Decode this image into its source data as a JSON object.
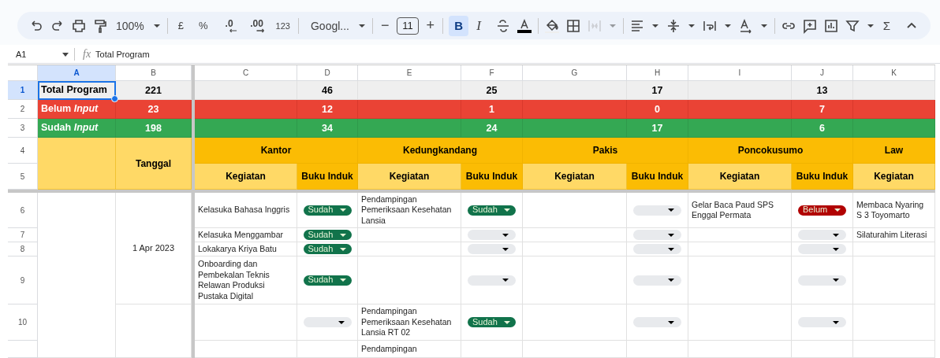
{
  "toolbar": {
    "zoom": "100%",
    "currency": "£",
    "percent": "%",
    "decrease_decimal": ".0",
    "increase_decimal": ".00",
    "number_format": "123",
    "font": "Googl...",
    "decrement": "−",
    "font_size": "11",
    "increment": "+",
    "bold": {
      "label": "B",
      "selected": true
    },
    "italic": "I",
    "merge_cells": {
      "disabled": true
    },
    "sum": "Σ"
  },
  "formula_bar": {
    "cell_ref": "A1",
    "fx": "fx",
    "formula": "Total Program"
  },
  "columns": [
    {
      "label": "A",
      "selected": true
    },
    {
      "label": "B",
      "selected": false
    },
    {
      "label": "C",
      "selected": false
    },
    {
      "label": "D",
      "selected": false
    },
    {
      "label": "E",
      "selected": false
    },
    {
      "label": "F",
      "selected": false
    },
    {
      "label": "G",
      "selected": false
    },
    {
      "label": "H",
      "selected": false
    },
    {
      "label": "I",
      "selected": false
    },
    {
      "label": "J",
      "selected": false
    },
    {
      "label": "K",
      "selected": false
    }
  ],
  "row_numbers": [
    {
      "label": "1",
      "selected": true
    },
    {
      "label": "2",
      "selected": false
    },
    {
      "label": "3",
      "selected": false
    },
    {
      "label": "4",
      "selected": false
    },
    {
      "label": "5",
      "selected": false
    },
    {
      "label": "6",
      "selected": false
    },
    {
      "label": "7",
      "selected": false
    },
    {
      "label": "8",
      "selected": false
    },
    {
      "label": "9",
      "selected": false
    },
    {
      "label": "10",
      "selected": false
    }
  ],
  "summary_rows": [
    {
      "kind": "total",
      "label": "Total Program",
      "total": "221",
      "counts": [
        "46",
        "25",
        "17",
        "13"
      ],
      "selected": true
    },
    {
      "kind": "belum",
      "label": "Belum *Input*",
      "total": "23",
      "counts": [
        "12",
        "1",
        "0",
        "7"
      ],
      "selected": false
    },
    {
      "kind": "sudah",
      "label": "Sudah *Input*",
      "total": "198",
      "counts": [
        "34",
        "24",
        "17",
        "6"
      ],
      "selected": false
    }
  ],
  "header": {
    "date_header": "Tanggal",
    "regions": [
      {
        "name": "Kantor",
        "activity_header": "Kegiatan",
        "status_header": "Buku Induk"
      },
      {
        "name": "Kedungkandang",
        "activity_header": "Kegiatan",
        "status_header": "Buku Induk"
      },
      {
        "name": "Pakis",
        "activity_header": "Kegiatan",
        "status_header": "Buku Induk"
      },
      {
        "name": "Poncokusumo",
        "activity_header": "Kegiatan",
        "status_header": "Buku Induk"
      },
      {
        "name": "Law",
        "activity_header": "Kegiatan"
      }
    ]
  },
  "date_groups": [
    {
      "date": "1 Apr 2023",
      "rows": [
        {
          "cells": [
            {
              "activity": "Kelasuka Bahasa Inggris",
              "color": "#11734b",
              "status_label": "Sudah"
            },
            {
              "activity": "Pendampingan Pemeriksaan Kesehatan Lansia",
              "color": "#11734b",
              "status_label": "Sudah"
            },
            {
              "color": "#e8eaed"
            },
            {
              "activity": "Gelar Baca Paud SPS Enggal Permata",
              "color": "#b10202",
              "status_label": "Belum"
            },
            {
              "activity": "Membaca Nyaring S 3 Toyomarto"
            }
          ]
        },
        {
          "cells": [
            {
              "activity": "Kelasuka Menggambar",
              "color": "#11734b",
              "status_label": "Sudah"
            },
            {
              "color": "#e8eaed"
            },
            {
              "color": "#e8eaed"
            },
            {
              "color": "#e8eaed"
            },
            {
              "activity": "Silaturahim Literasi"
            }
          ]
        },
        {
          "cells": [
            {
              "activity": "Lokakarya Kriya Batu",
              "color": "#11734b",
              "status_label": "Sudah"
            },
            {
              "color": "#e8eaed"
            },
            {
              "color": "#e8eaed"
            },
            {
              "color": "#e8eaed"
            },
            {}
          ]
        },
        {
          "cells": [
            {
              "activity": "Onboarding dan Pembekalan Teknis Relawan Produksi Pustaka Digital",
              "color": "#11734b",
              "status_label": "Sudah"
            },
            {
              "color": "#e8eaed"
            },
            {
              "color": "#e8eaed"
            },
            {
              "color": "#e8eaed"
            },
            {}
          ]
        }
      ]
    },
    {
      "rows": [
        {
          "cells": [
            {
              "color": "#e8eaed"
            },
            {
              "activity": "Pendampingan Pemeriksaan Kesehatan Lansia RT 02",
              "color": "#11734b",
              "status_label": "Sudah"
            },
            {
              "color": "#e8eaed"
            },
            {
              "color": "#e8eaed"
            },
            {}
          ]
        },
        {
          "cells": [
            {},
            {
              "activity": "Pendampingan"
            },
            {},
            {},
            {}
          ]
        }
      ]
    }
  ]
}
